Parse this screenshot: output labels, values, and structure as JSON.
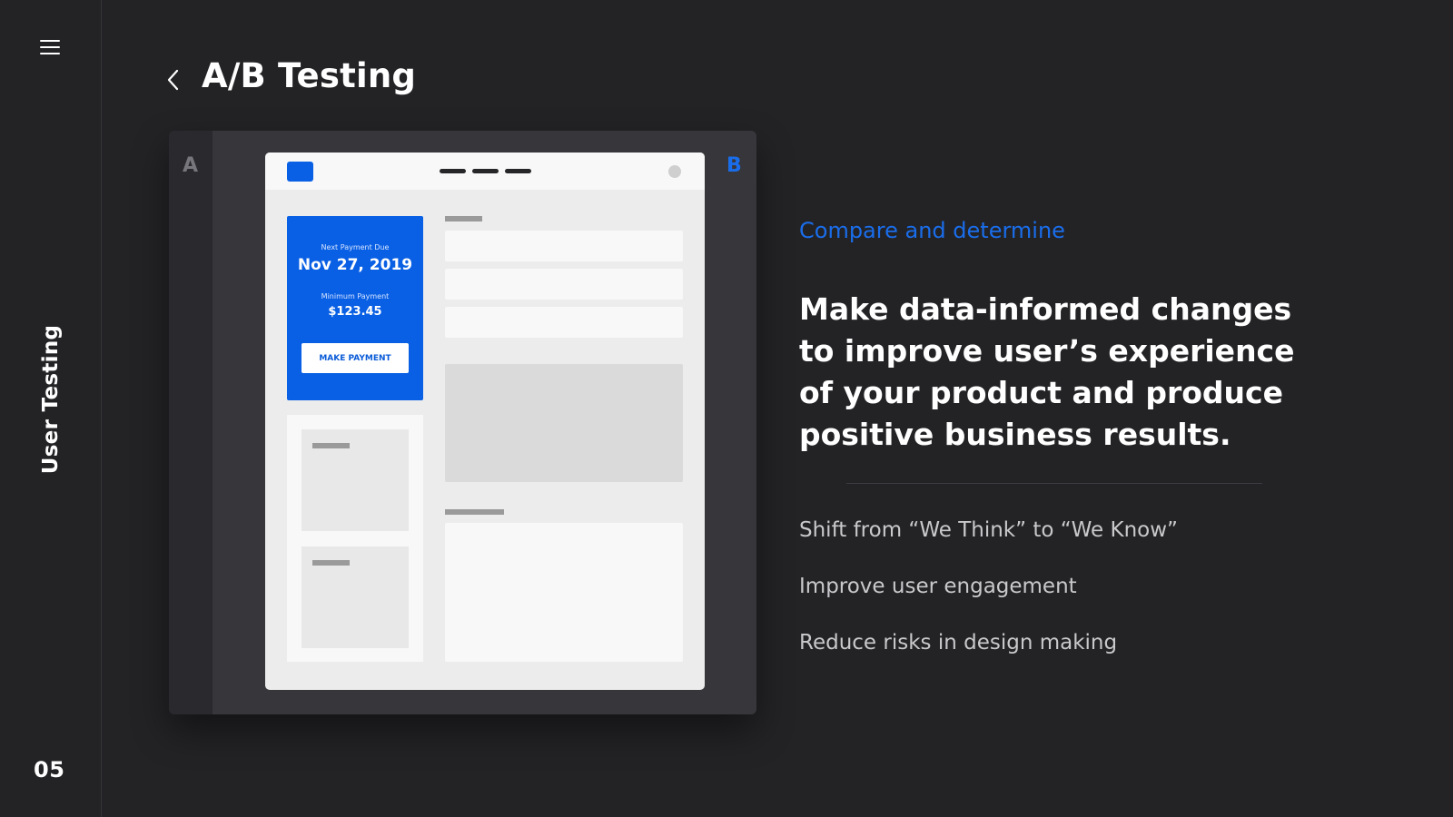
{
  "sidebar": {
    "section_label": "User Testing",
    "page_number": "05",
    "menu_icon": "hamburger-menu-icon"
  },
  "header": {
    "back_icon": "chevron-left-icon",
    "title": "A/B Testing"
  },
  "compare": {
    "variant_a": "A",
    "variant_b": "B",
    "mockup": {
      "payment_card": {
        "due_label": "Next Payment Due",
        "due_date": "Nov 27, 2019",
        "min_label": "Minimum Payment",
        "min_amount": "$123.45",
        "button_label": "MAKE PAYMENT"
      }
    }
  },
  "content": {
    "eyebrow": "Compare and determine",
    "headline": "Make data-informed changes to improve user’s experience of your product and produce positive business results.",
    "benefits": [
      "Shift from “We Think” to “We Know”",
      "Improve user engagement",
      "Reduce risks in design making"
    ]
  },
  "colors": {
    "background": "#232326",
    "accent": "#1a6dea",
    "card_blue": "#0a60e4"
  }
}
